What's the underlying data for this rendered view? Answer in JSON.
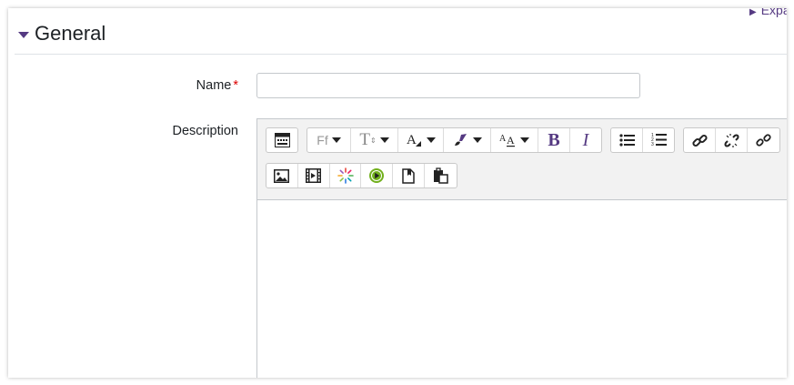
{
  "header": {
    "expand_all": "Expa"
  },
  "section": {
    "title": "General"
  },
  "form": {
    "name_label": "Name",
    "required_marker": "*",
    "name_value": "",
    "description_label": "Description"
  },
  "toolbar": {
    "font_family_label": "Ff",
    "font_size_label": "T",
    "bold_label": "B",
    "italic_label": "I",
    "icons": [
      "toolbar-toggle-icon",
      "font-family-icon",
      "font-size-icon",
      "font-color-icon",
      "background-color-icon",
      "text-style-icon",
      "bold-icon",
      "italic-icon",
      "unordered-list-icon",
      "ordered-list-icon",
      "link-icon",
      "unlink-icon",
      "anchor-icon",
      "image-icon",
      "media-icon",
      "manage-files-icon",
      "recordrtc-icon",
      "h5p-icon",
      "copy-icon",
      "paste-icon"
    ]
  },
  "colors": {
    "accent": "#553a82",
    "required": "#dd0000",
    "toolbar_bg": "#f2f2f2",
    "h5p_green": "#72b01d"
  }
}
